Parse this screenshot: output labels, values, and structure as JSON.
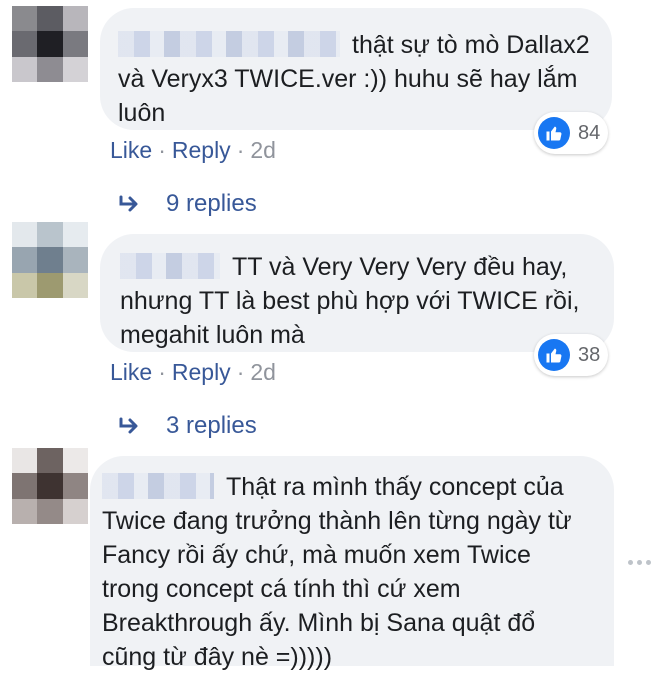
{
  "comments": [
    {
      "text_lines": [
        "thật sự tò mò Dallax2",
        "và Veryx3 TWICE.ver :)) huhu sẽ hay lắm",
        "luôn"
      ],
      "reaction_count": "84",
      "actions": {
        "like": "Like",
        "reply": "Reply",
        "sep": "·",
        "time": "2d"
      },
      "replies_label": "9 replies"
    },
    {
      "text_lines": [
        "TT và Very Very Very đều hay,",
        "nhưng TT là best phù hợp với TWICE rồi,",
        "megahit luôn mà"
      ],
      "reaction_count": "38",
      "actions": {
        "like": "Like",
        "reply": "Reply",
        "sep": "·",
        "time": "2d"
      },
      "replies_label": "3 replies"
    },
    {
      "text_lines": [
        "Thật ra mình thấy concept của",
        "Twice đang trưởng thành lên từng ngày từ",
        "Fancy rồi ấy chứ, mà muốn xem Twice",
        "trong concept cá tính thì cứ xem",
        "Breakthrough ấy. Mình bị Sana quật đổ",
        "cũng từ đây nè =)))))"
      ]
    }
  ],
  "colors": {
    "link": "#385898",
    "bubble": "#f0f2f5",
    "like_blue": "#1877f2",
    "meta_gray": "#90949c"
  },
  "icons": [
    "like-icon",
    "reply-arrow-icon",
    "more-options-icon"
  ]
}
